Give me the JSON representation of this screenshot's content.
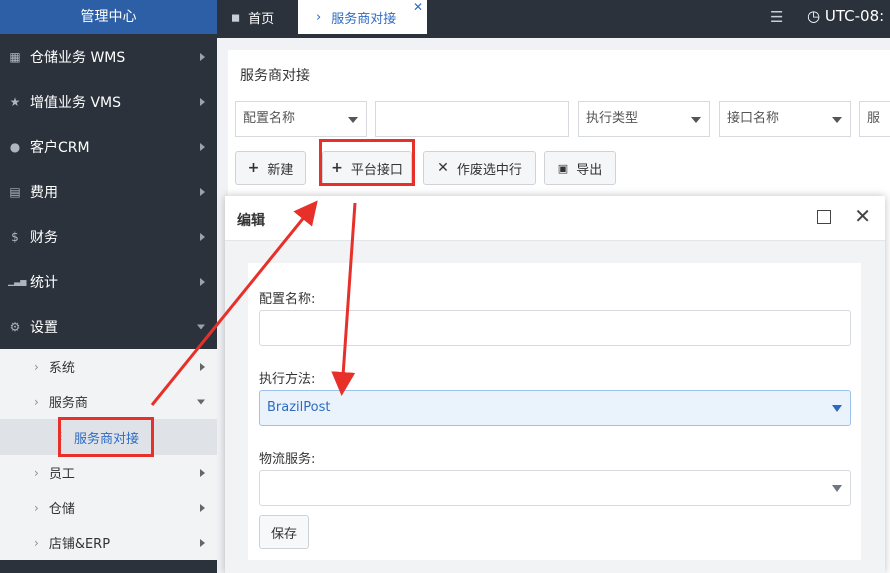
{
  "sidebar": {
    "brand": "管理中心",
    "menu": [
      {
        "icon": "bank-icon",
        "glyph": "▦",
        "label": "仓储业务 WMS"
      },
      {
        "icon": "star-icon",
        "glyph": "★",
        "label": "增值业务 VMS"
      },
      {
        "icon": "user-icon",
        "glyph": "●",
        "label": "客户CRM"
      },
      {
        "icon": "table-icon",
        "glyph": "▤",
        "label": "费用"
      },
      {
        "icon": "dollar-icon",
        "glyph": "$",
        "label": "财务"
      },
      {
        "icon": "signal-icon",
        "glyph": "▁▃▅",
        "label": "统计"
      },
      {
        "icon": "gear-icon",
        "glyph": "⚙",
        "label": "设置"
      }
    ],
    "submenu": {
      "system": "系统",
      "provider": "服务商",
      "provider_integration": "服务商对接",
      "staff": "员工",
      "warehouse": "仓储",
      "shop_erp": "店铺&ERP"
    }
  },
  "topbar": {
    "home_tab": "首页",
    "active_tab": "服务商对接",
    "clock": "UTC-08:"
  },
  "page": {
    "title": "服务商对接",
    "filters": {
      "config_name": "配置名称",
      "exec_type": "执行类型",
      "api_name": "接口名称",
      "provider_partial": "服务"
    },
    "buttons": {
      "new": "新建",
      "platform_api": "平台接口",
      "void_selected": "作废选中行",
      "export": "导出"
    }
  },
  "modal": {
    "title": "编辑",
    "config_name_label": "配置名称:",
    "config_name_value": "",
    "exec_method_label": "执行方法:",
    "exec_method_value": "BrazilPost",
    "logistics_label": "物流服务:",
    "logistics_value": "",
    "save": "保存"
  },
  "colors": {
    "sidebar_bg": "#2b323b",
    "brand_bg": "#2d5fa6",
    "accent": "#2d6bc2",
    "highlight_red": "#e8302a"
  }
}
